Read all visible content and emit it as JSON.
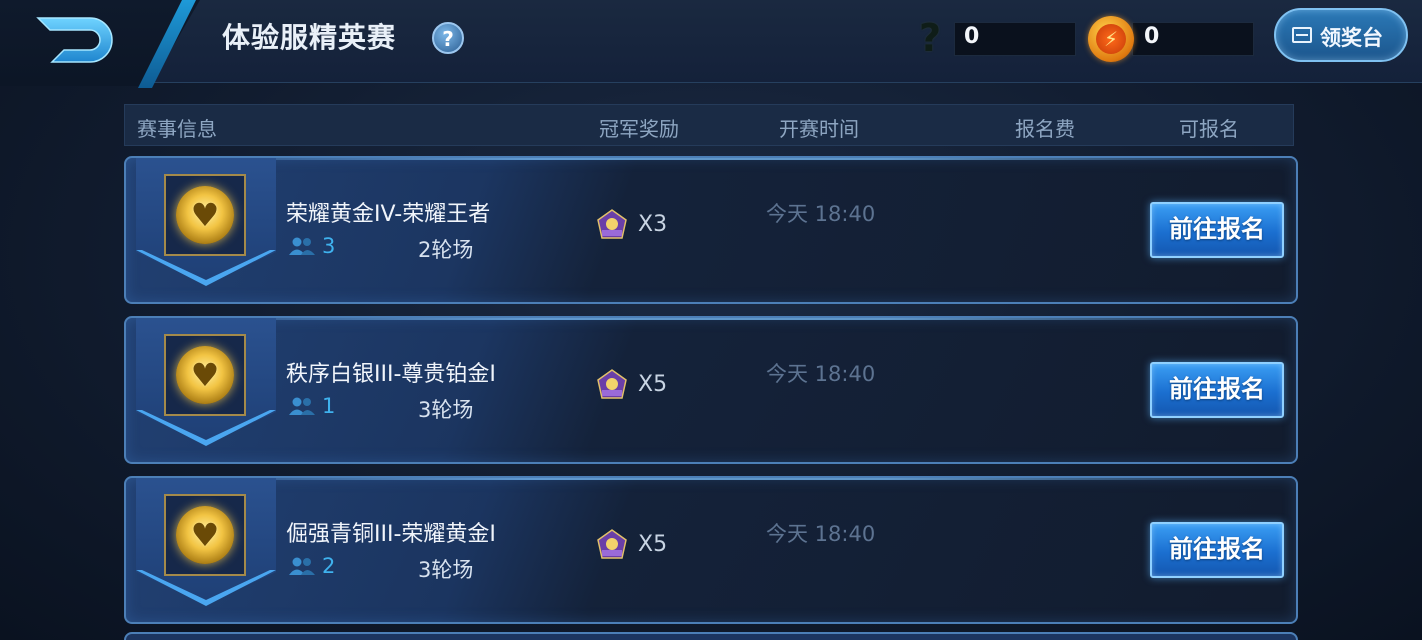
{
  "header": {
    "title": "体验服精英赛",
    "help_icon_label": "?",
    "currency1": {
      "icon": "question-mark-icon",
      "icon_glyph": "?",
      "value": "0"
    },
    "currency2": {
      "icon": "coin-icon",
      "value": "0"
    },
    "award_button_label": "领奖台"
  },
  "columns": {
    "info": "赛事信息",
    "reward": "冠军奖励",
    "start_time": "开赛时间",
    "fee": "报名费",
    "available": "可报名"
  },
  "events": [
    {
      "name": "荣耀黄金IV-荣耀王者",
      "players": "3",
      "rounds": "2轮场",
      "reward_qty": "X3",
      "start_time": "今天 18:40",
      "button_label": "前往报名"
    },
    {
      "name": "秩序白银III-尊贵铂金I",
      "players": "1",
      "rounds": "3轮场",
      "reward_qty": "X5",
      "start_time": "今天 18:40",
      "button_label": "前往报名"
    },
    {
      "name": "倔强青铜III-荣耀黄金I",
      "players": "2",
      "rounds": "3轮场",
      "reward_qty": "X5",
      "start_time": "今天 18:40",
      "button_label": "前往报名"
    }
  ],
  "colors": {
    "accent": "#3fb2ee",
    "button": "#1b6fd0",
    "row_border": "#4c7fb7"
  }
}
